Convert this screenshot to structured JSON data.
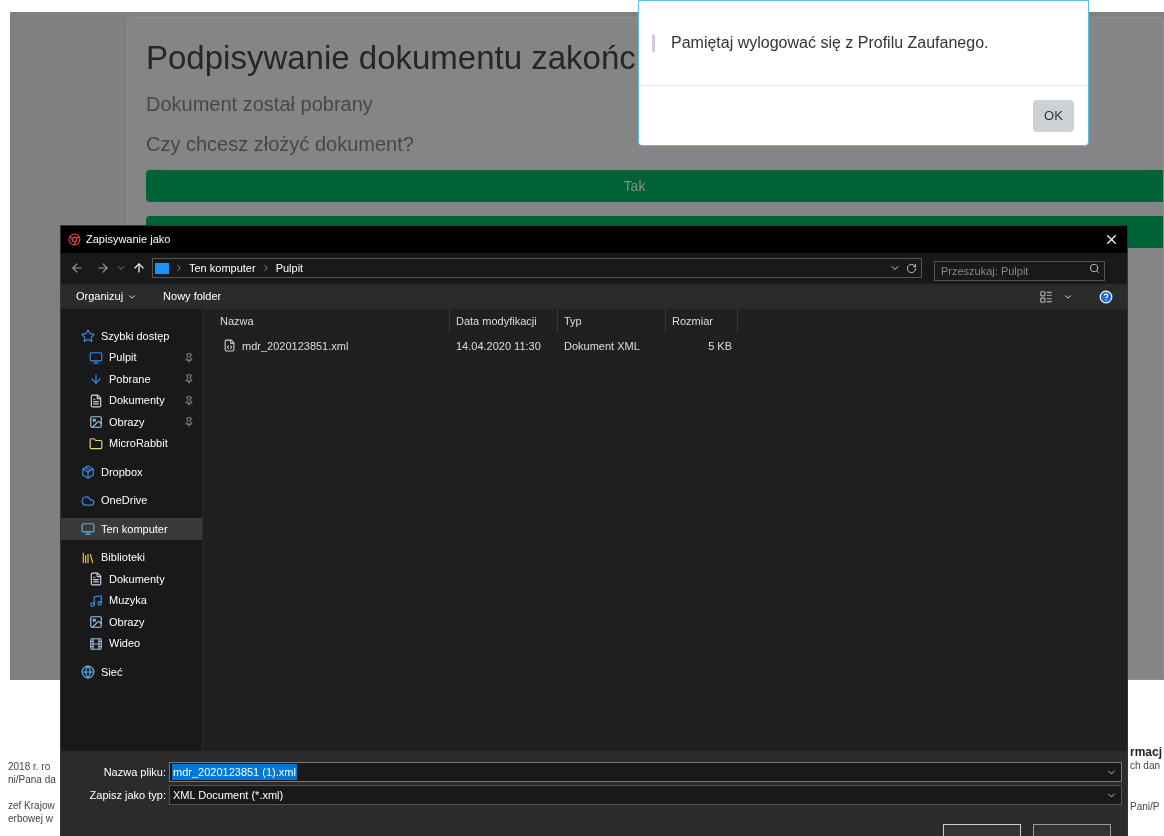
{
  "page": {
    "title": "Podpisywanie dokumentu zakońc",
    "subtitle": "Dokument został pobrany",
    "question": "Czy chcesz złożyć dokument?",
    "confirm_button": "Tak"
  },
  "footer_left": [
    "2018 r. ro",
    "ni/Pana da",
    "zef Krajow",
    "erbowej w"
  ],
  "footer_right": [
    {
      "text": "rmacj",
      "kind": "heading"
    },
    {
      "text": "ch dan",
      "kind": "text"
    },
    {
      "text": "Pani/P",
      "kind": "text"
    }
  ],
  "alert": {
    "message": "Pamiętaj wylogować się z Profilu Zaufanego.",
    "ok_button": "OK"
  },
  "save_dialog": {
    "title": "Zapisywanie jako",
    "path": [
      "Ten komputer",
      "Pulpit"
    ],
    "search_placeholder": "Przeszukaj: Pulpit",
    "toolbar": {
      "organize": "Organizuj",
      "new_folder": "Nowy folder"
    },
    "sidebar": [
      {
        "label": "Szybki dostęp",
        "selected": false,
        "children": [
          {
            "label": "Pulpit",
            "pinned": true,
            "selected": false
          },
          {
            "label": "Pobrane",
            "pinned": true,
            "selected": false
          },
          {
            "label": "Dokumenty",
            "pinned": true,
            "selected": false
          },
          {
            "label": "Obrazy",
            "pinned": true,
            "selected": false
          },
          {
            "label": "MicroRabbit",
            "pinned": false,
            "selected": false
          }
        ]
      },
      {
        "label": "Dropbox",
        "selected": false
      },
      {
        "label": "OneDrive",
        "selected": false
      },
      {
        "label": "Ten komputer",
        "selected": true
      },
      {
        "label": "Biblioteki",
        "selected": false,
        "children": [
          {
            "label": "Dokumenty",
            "pinned": false,
            "selected": false
          },
          {
            "label": "Muzyka",
            "pinned": false,
            "selected": false
          },
          {
            "label": "Obrazy",
            "pinned": false,
            "selected": false
          },
          {
            "label": "Wideo",
            "pinned": false,
            "selected": false
          }
        ]
      },
      {
        "label": "Sieć",
        "selected": false
      }
    ],
    "columns": [
      "Nazwa",
      "Data modyfikacji",
      "Typ",
      "Rozmiar"
    ],
    "files": [
      {
        "name": "mdr_2020123851.xml",
        "date": "14.04.2020 11:30",
        "type": "Dokument XML",
        "size": "5 KB"
      }
    ],
    "filename_label": "Nazwa pliku:",
    "filename_value": "mdr_2020123851 (1).xml",
    "filename_selected": true,
    "filetype_label": "Zapisz jako typ:",
    "filetype_value": "XML Document (*.xml)"
  }
}
